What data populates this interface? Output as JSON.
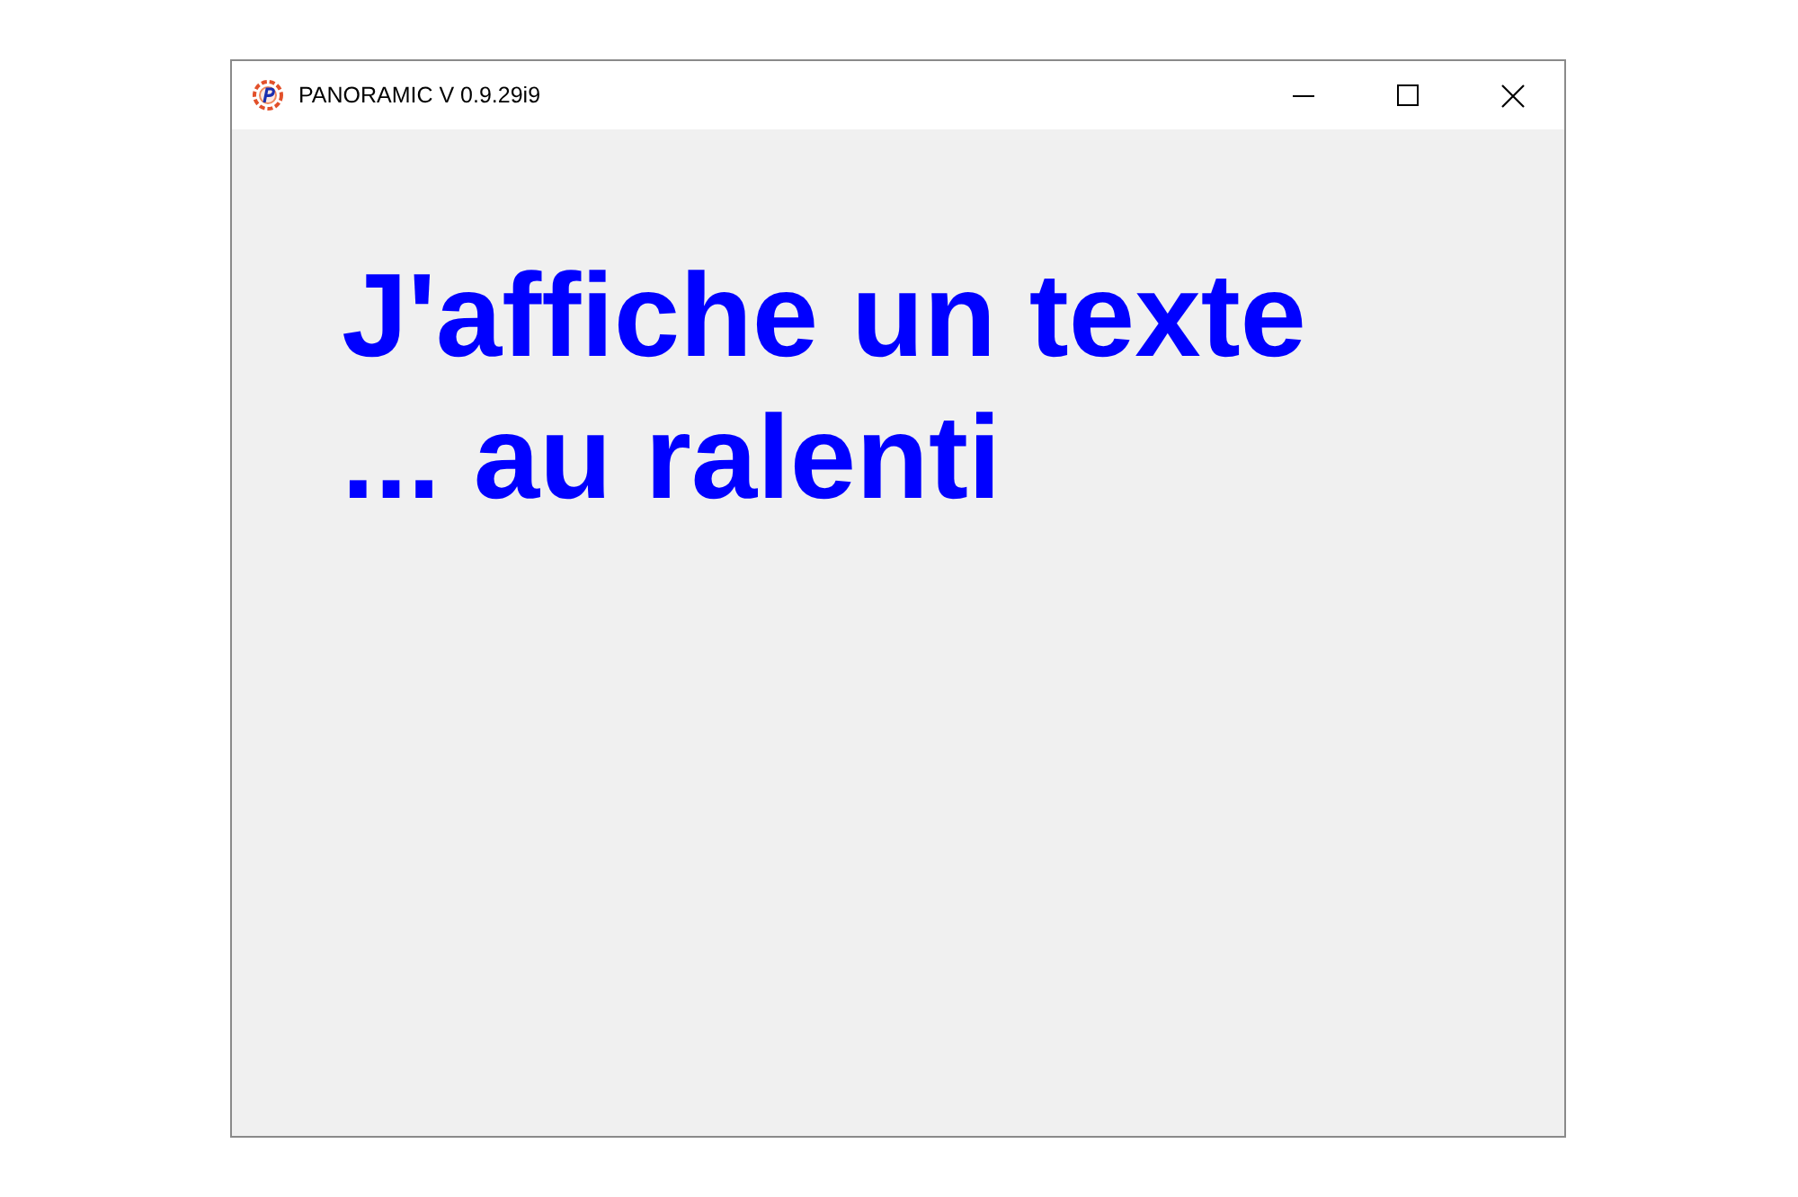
{
  "window": {
    "title": "PANORAMIC V 0.9.29i9"
  },
  "content": {
    "lines": [
      "J'affiche un texte",
      "... au ralenti"
    ]
  }
}
